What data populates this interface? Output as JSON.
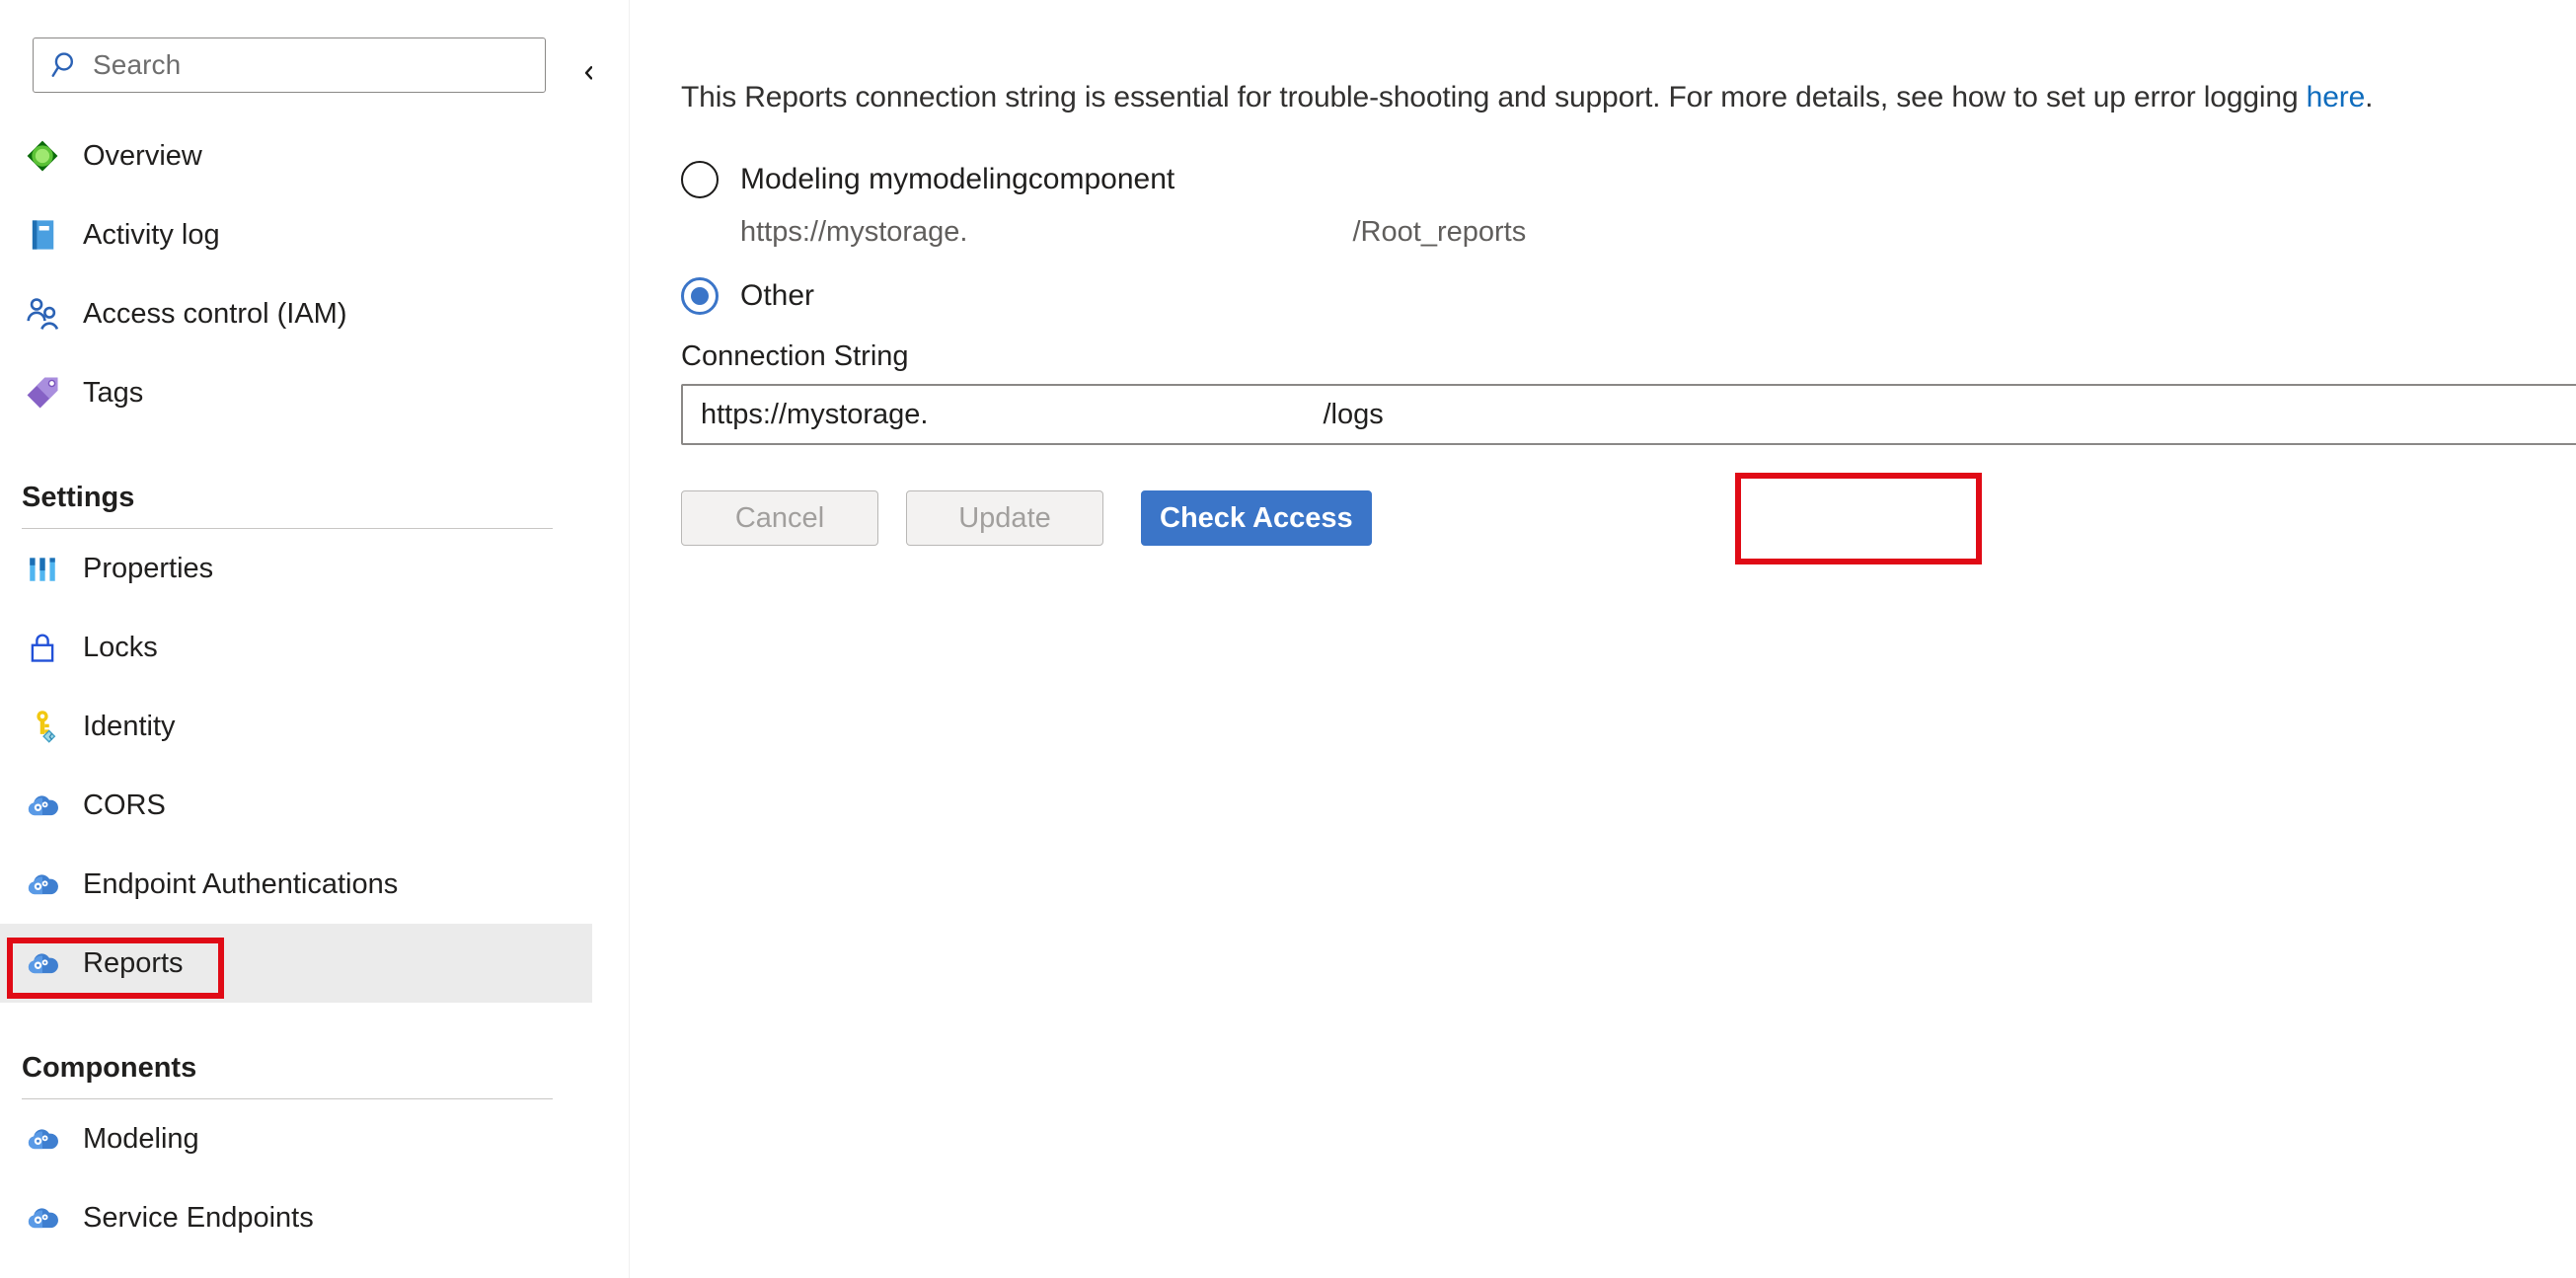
{
  "sidebar": {
    "search": {
      "placeholder": "Search",
      "value": "",
      "icon": "search-icon"
    },
    "collapse_glyph": "«",
    "items": [
      {
        "type": "item",
        "label": "Overview",
        "icon": "overview-icon",
        "selected": false
      },
      {
        "type": "item",
        "label": "Activity log",
        "icon": "activity-log-icon",
        "selected": false
      },
      {
        "type": "item",
        "label": "Access control (IAM)",
        "icon": "access-control-icon",
        "selected": false
      },
      {
        "type": "item",
        "label": "Tags",
        "icon": "tags-icon",
        "selected": false
      },
      {
        "type": "group",
        "label": "Settings"
      },
      {
        "type": "item",
        "label": "Properties",
        "icon": "properties-icon",
        "selected": false
      },
      {
        "type": "item",
        "label": "Locks",
        "icon": "lock-icon",
        "selected": false
      },
      {
        "type": "item",
        "label": "Identity",
        "icon": "key-icon",
        "selected": false
      },
      {
        "type": "item",
        "label": "CORS",
        "icon": "cloud-gear-icon",
        "selected": false
      },
      {
        "type": "item",
        "label": "Endpoint Authentications",
        "icon": "cloud-gear-icon",
        "selected": false
      },
      {
        "type": "item",
        "label": "Reports",
        "icon": "cloud-gear-icon",
        "selected": true
      },
      {
        "type": "group",
        "label": "Components"
      },
      {
        "type": "item",
        "label": "Modeling",
        "icon": "cloud-gear-icon",
        "selected": false
      },
      {
        "type": "item",
        "label": "Service Endpoints",
        "icon": "cloud-gear-icon",
        "selected": false
      }
    ]
  },
  "main": {
    "description": {
      "before_link": "This Reports connection string is essential for trouble-shooting and support. For more details, see how to set up error logging ",
      "link_text": "here",
      "after_link": "."
    },
    "radios": [
      {
        "label": "Modeling mymodelingcomponent",
        "checked": false,
        "sub_prefix": "https://mystorage.",
        "sub_suffix": "/Root_reports"
      },
      {
        "label": "Other",
        "checked": true
      }
    ],
    "connection_string": {
      "label": "Connection String",
      "value_prefix": "https://mystorage.",
      "value_suffix": "/logs",
      "placeholder": "Connection String"
    },
    "buttons": {
      "cancel": "Cancel",
      "update": "Update",
      "check_access": "Check Access"
    }
  },
  "colors": {
    "accent": "#3b75c8",
    "link": "#0f6cbd",
    "annotation": "#e00b16",
    "selected_row": "#ebebeb",
    "text": "#201f1e",
    "muted": "#605e5c"
  }
}
